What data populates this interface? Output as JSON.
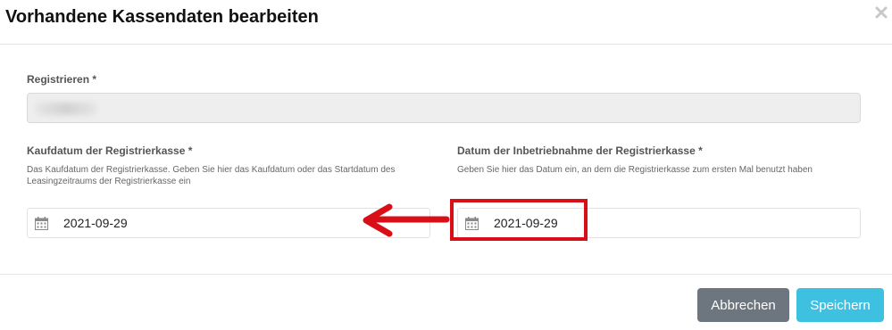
{
  "modal": {
    "title": "Vorhandene Kassendaten bearbeiten"
  },
  "icons": {
    "close": "close-icon",
    "calendar": "calendar-icon"
  },
  "form": {
    "register": {
      "label": "Registrieren *"
    },
    "purchase_date": {
      "label": "Kaufdatum der Registrierkasse *",
      "help": "Das Kaufdatum der Registrierkasse. Geben Sie hier das Kaufdatum oder das Startdatum des Leasingzeitraums der Registrierkasse ein",
      "value": "2021-09-29"
    },
    "commissioning_date": {
      "label": "Datum der Inbetriebnahme der Registrierkasse *",
      "help": "Geben Sie hier das Datum ein, an dem die Registrierkasse zum ersten Mal benutzt haben",
      "value": "2021-09-29"
    }
  },
  "footer": {
    "cancel_label": "Abbrechen",
    "save_label": "Speichern"
  },
  "colors": {
    "cancel_button": "#6d767e",
    "save_button": "#3ec0e0",
    "annotation": "#d90f17",
    "readonly_background": "#eeeeee"
  }
}
